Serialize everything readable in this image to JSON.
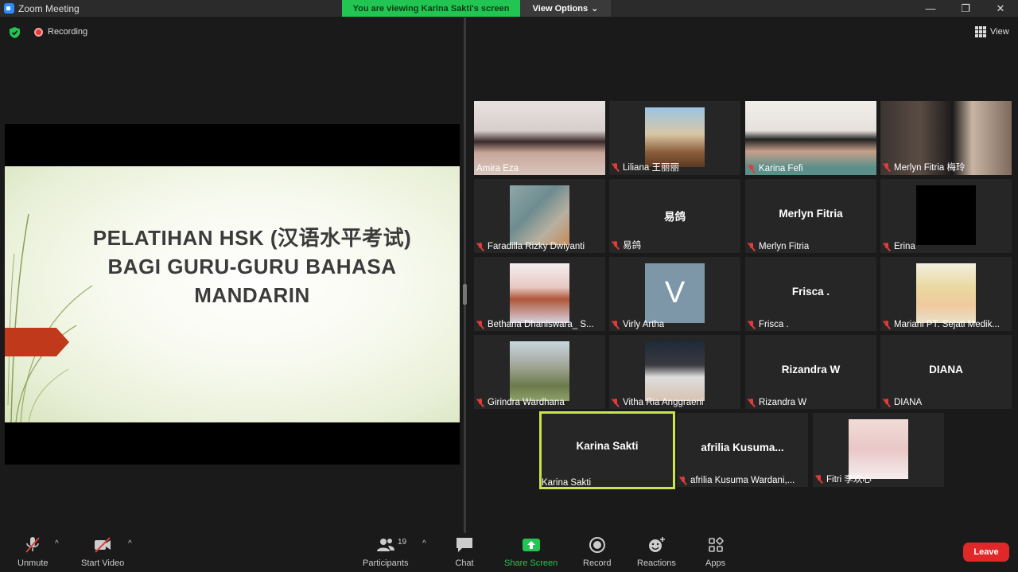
{
  "window": {
    "title": "Zoom Meeting",
    "minimize": "—",
    "maximize": "❐",
    "close": "✕"
  },
  "banner": {
    "viewing_text": "You are viewing Karina Sakti's screen",
    "view_options": "View Options",
    "view_options_caret": "⌄"
  },
  "status": {
    "recording": "Recording",
    "view_label": "View"
  },
  "slide": {
    "title_line1": "PELATIHAN HSK (汉语水平考试)",
    "title_line2": "BAGI GURU-GURU BAHASA",
    "title_line3": "MANDARIN"
  },
  "gallery": [
    {
      "name": "Amira Eza",
      "muted": false,
      "kind": "video"
    },
    {
      "name": "Liliana 王丽丽",
      "muted": true,
      "kind": "photo"
    },
    {
      "name": "Karina Fefi",
      "muted": true,
      "kind": "video"
    },
    {
      "name": "Merlyn Fitria 梅玲",
      "muted": true,
      "kind": "video"
    },
    {
      "name": "Faradilla Rizky Dwiyanti",
      "muted": true,
      "kind": "photo"
    },
    {
      "name": "易鸽",
      "center": "易鸽",
      "muted": true,
      "kind": "text"
    },
    {
      "name": "Merlyn Fitria",
      "center": "Merlyn Fitria",
      "muted": true,
      "kind": "text"
    },
    {
      "name": "Erina",
      "muted": true,
      "kind": "photo"
    },
    {
      "name": "Betharia Dhaniswara_ S...",
      "muted": true,
      "kind": "photo"
    },
    {
      "name": "Virly Artha",
      "muted": true,
      "kind": "avatar",
      "initial": "V"
    },
    {
      "name": "Frisca .",
      "center": "Frisca .",
      "muted": true,
      "kind": "text"
    },
    {
      "name": "Mariani PT. Sejati Medik...",
      "muted": true,
      "kind": "photo"
    },
    {
      "name": "Girindra Wardhana",
      "muted": true,
      "kind": "photo"
    },
    {
      "name": "Vitha Ria Anggraeni",
      "muted": true,
      "kind": "photo"
    },
    {
      "name": "Rizandra W",
      "center": "Rizandra W",
      "muted": true,
      "kind": "text"
    },
    {
      "name": "DIANA",
      "center": "DIANA",
      "muted": true,
      "kind": "text"
    },
    {
      "name": "Karina Sakti",
      "center": "Karina Sakti",
      "muted": false,
      "kind": "text",
      "active": true
    },
    {
      "name": "afrilia Kusuma Wardani,...",
      "center": "afrilia  Kusuma...",
      "muted": true,
      "kind": "text"
    },
    {
      "name": "Fitri 李欢心",
      "muted": true,
      "kind": "photo"
    }
  ],
  "toolbar": {
    "unmute": "Unmute",
    "start_video": "Start Video",
    "participants": "Participants",
    "participants_count": "19",
    "chat": "Chat",
    "share_screen": "Share Screen",
    "record": "Record",
    "reactions": "Reactions",
    "apps": "Apps",
    "leave": "Leave",
    "caret": "^"
  },
  "colors": {
    "share_green": "#23c552",
    "leave_red": "#e02828",
    "active_outline": "#c8e64a",
    "slide_arrow": "#c0391b"
  }
}
